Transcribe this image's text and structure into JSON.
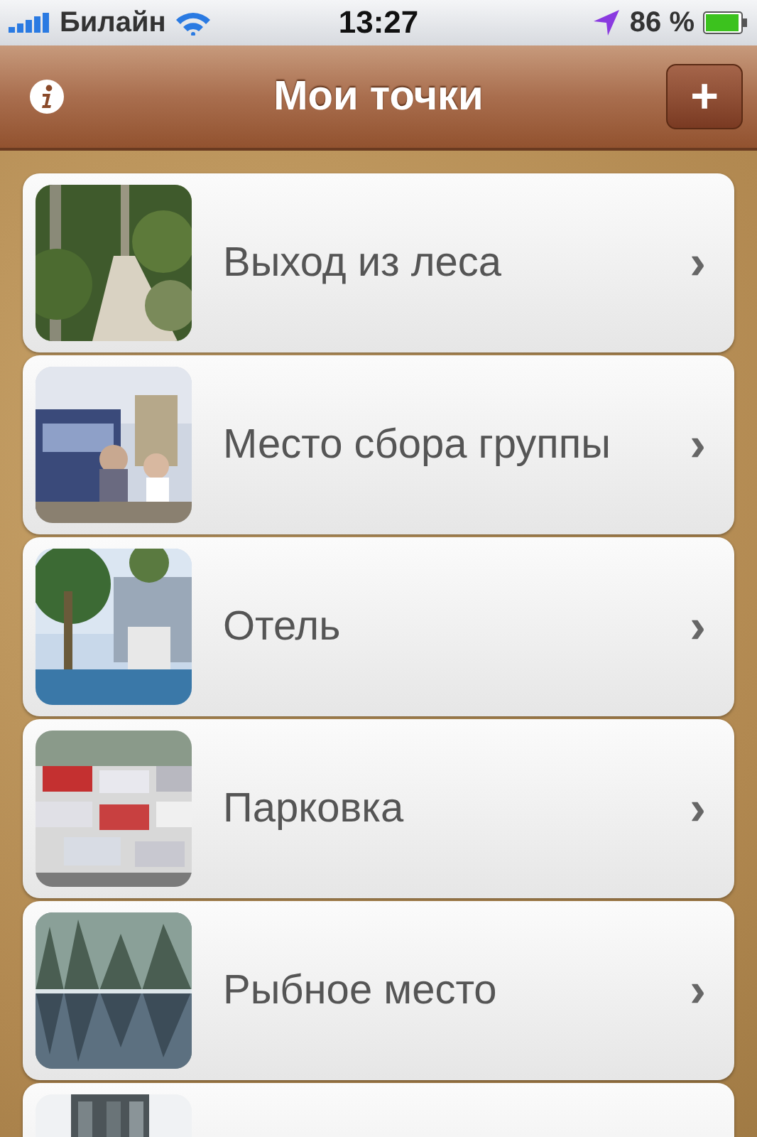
{
  "status_bar": {
    "carrier": "Билайн",
    "time": "13:27",
    "battery": "86 %"
  },
  "nav_bar": {
    "title": "Мои точки",
    "add_button": "+"
  },
  "places": [
    {
      "kind": "full",
      "name": "Выход из леса",
      "chevron": "›"
    },
    {
      "kind": "full",
      "name": "Место сбора группы",
      "chevron": "›"
    },
    {
      "kind": "full",
      "name": "Отель",
      "chevron": "›"
    },
    {
      "kind": "full",
      "name": "Парковка",
      "chevron": "›"
    },
    {
      "kind": "full",
      "name": "Рыбное место",
      "chevron": "›"
    },
    {
      "kind": "partial"
    }
  ]
}
